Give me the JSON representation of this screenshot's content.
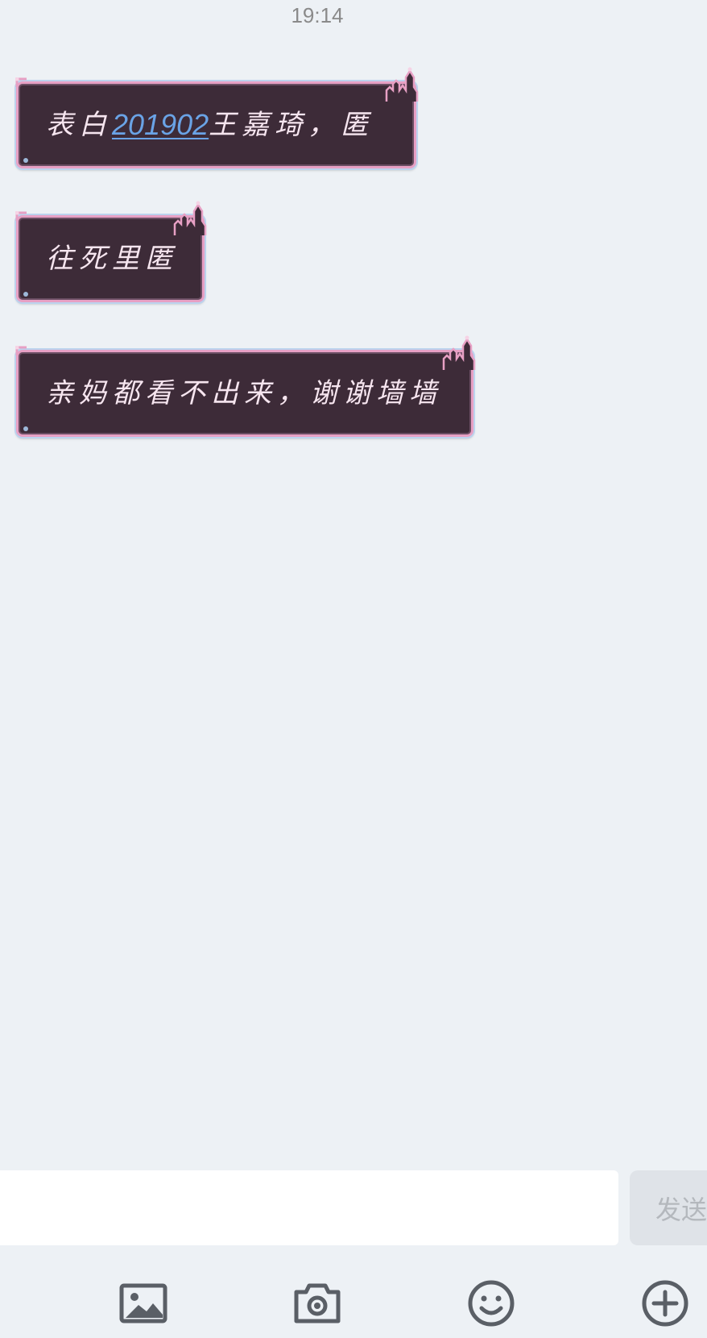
{
  "header": {
    "time": "19:14"
  },
  "messages": [
    {
      "prefix": "表白",
      "link": "201902",
      "suffix": "王嘉琦，匿"
    },
    {
      "text": "往死里匿"
    },
    {
      "text": "亲妈都看不出来，谢谢墙墙"
    }
  ],
  "composer": {
    "input_value": "",
    "input_placeholder": "",
    "send_label": "发送"
  },
  "toolbar": {
    "icons": [
      "image-icon",
      "camera-icon",
      "emoji-icon",
      "plus-icon"
    ]
  },
  "colors": {
    "background": "#edf1f5",
    "bubble": "#3d2b38",
    "bubble_border": "#e7a0c4",
    "link": "#6aa3e6",
    "icon": "#5a5f66"
  }
}
